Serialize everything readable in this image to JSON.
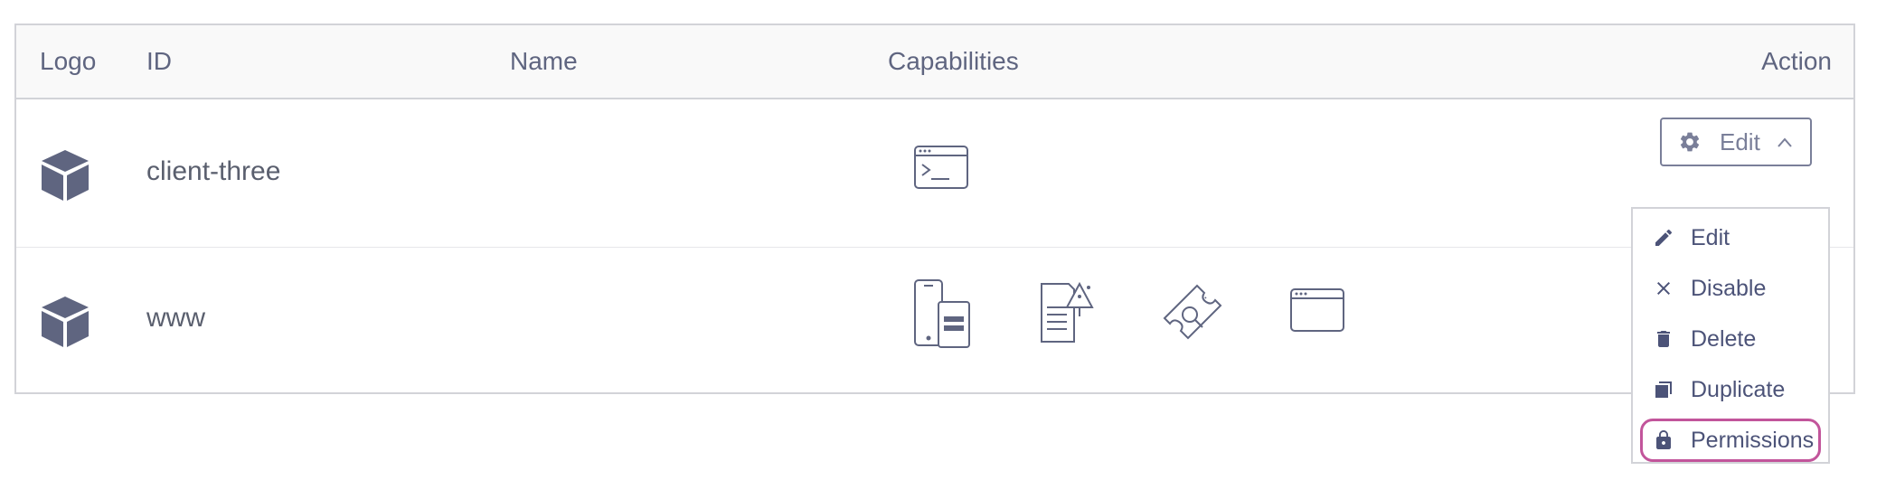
{
  "table": {
    "headers": {
      "logo": "Logo",
      "id": "ID",
      "name": "Name",
      "capabilities": "Capabilities",
      "action": "Action"
    },
    "rows": [
      {
        "id": "client-three",
        "name": "",
        "capabilities": [
          "terminal-icon"
        ]
      },
      {
        "id": "www",
        "name": "",
        "capabilities": [
          "mobile-device-icon",
          "document-tree-icon",
          "ticket-search-icon",
          "browser-window-icon"
        ]
      }
    ]
  },
  "action_button": {
    "label": "Edit",
    "icon": "gear-icon",
    "chevron": "chevron-up-icon"
  },
  "dropdown": {
    "items": [
      {
        "label": "Edit",
        "icon": "pencil-icon"
      },
      {
        "label": "Disable",
        "icon": "close-icon"
      },
      {
        "label": "Delete",
        "icon": "trash-icon"
      },
      {
        "label": "Duplicate",
        "icon": "copy-icon"
      },
      {
        "label": "Permissions",
        "icon": "lock-icon",
        "highlighted": true
      }
    ]
  },
  "colors": {
    "icon": "#5f6580",
    "border": "#d2d3d8",
    "highlight": "#c2559b"
  }
}
